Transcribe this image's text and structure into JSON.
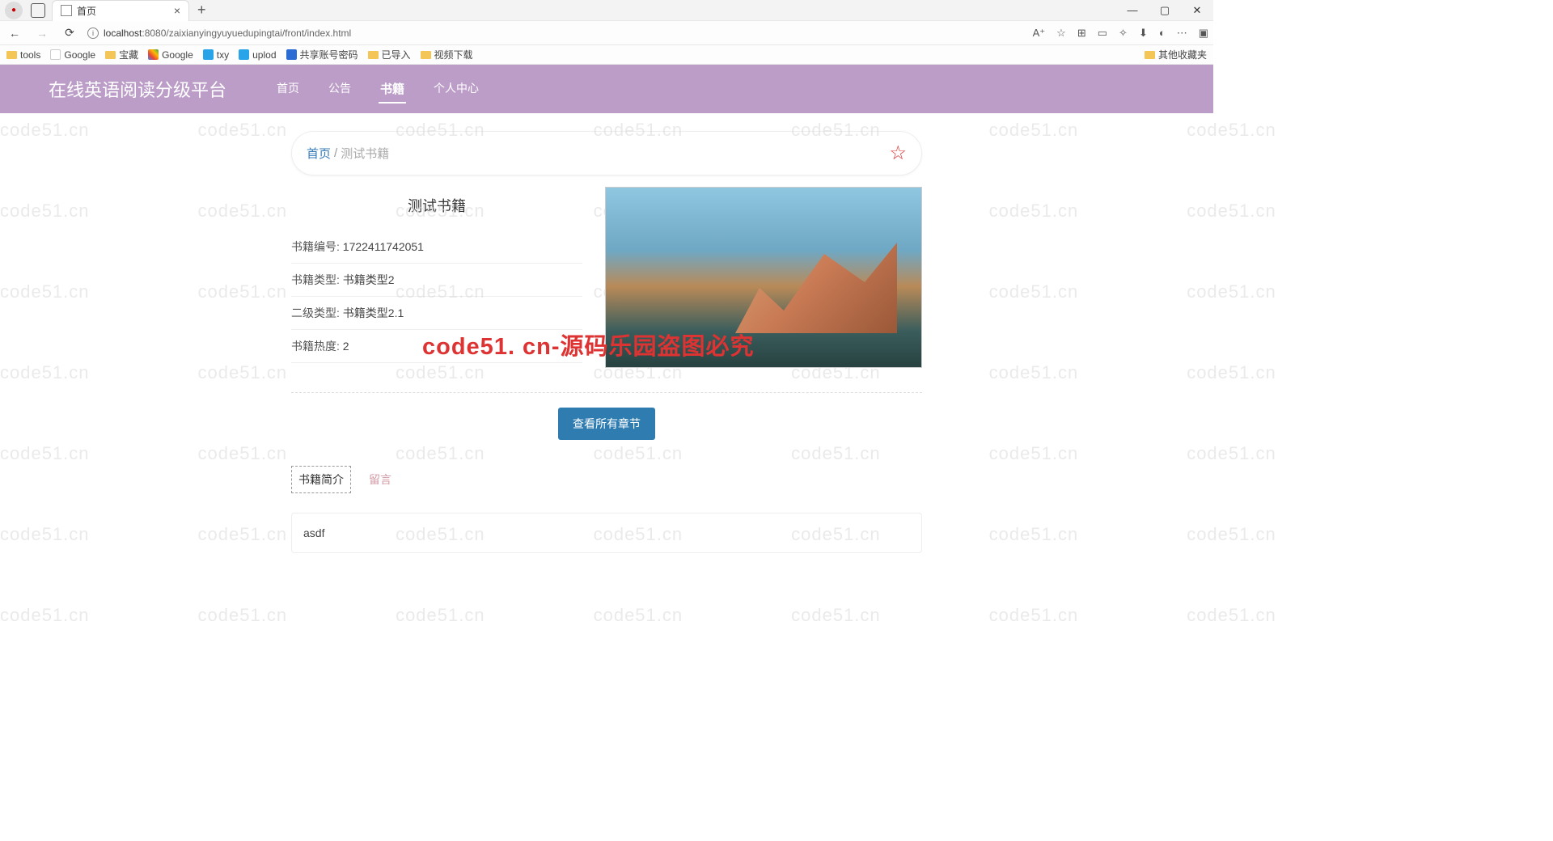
{
  "browser": {
    "tab_title": "首页",
    "url_host": "localhost",
    "url_port_path": ":8080/zaixianyingyuyuedupingtai/front/index.html",
    "bookmarks": [
      "tools",
      "Google",
      "宝藏",
      "Google",
      "txy",
      "uplod",
      "共享账号密码",
      "已导入",
      "视频下载"
    ],
    "other_bookmarks": "其他收藏夹"
  },
  "header": {
    "brand": "在线英语阅读分级平台",
    "nav": [
      "首页",
      "公告",
      "书籍",
      "个人中心"
    ],
    "active_index": 2
  },
  "breadcrumb": {
    "home": "首页",
    "current": "测试书籍"
  },
  "book": {
    "title": "测试书籍",
    "fields": [
      {
        "label": "书籍编号:",
        "value": "1722411742051"
      },
      {
        "label": "书籍类型:",
        "value": "书籍类型2"
      },
      {
        "label": "二级类型:",
        "value": "书籍类型2.1"
      },
      {
        "label": "书籍热度:",
        "value": "2"
      }
    ]
  },
  "buttons": {
    "view_chapters": "查看所有章节"
  },
  "tabs": {
    "intro": "书籍简介",
    "comment": "留言"
  },
  "intro_text": "asdf",
  "watermark": {
    "repeat": "code51.cn",
    "center": "code51. cn-源码乐园盗图必究"
  }
}
